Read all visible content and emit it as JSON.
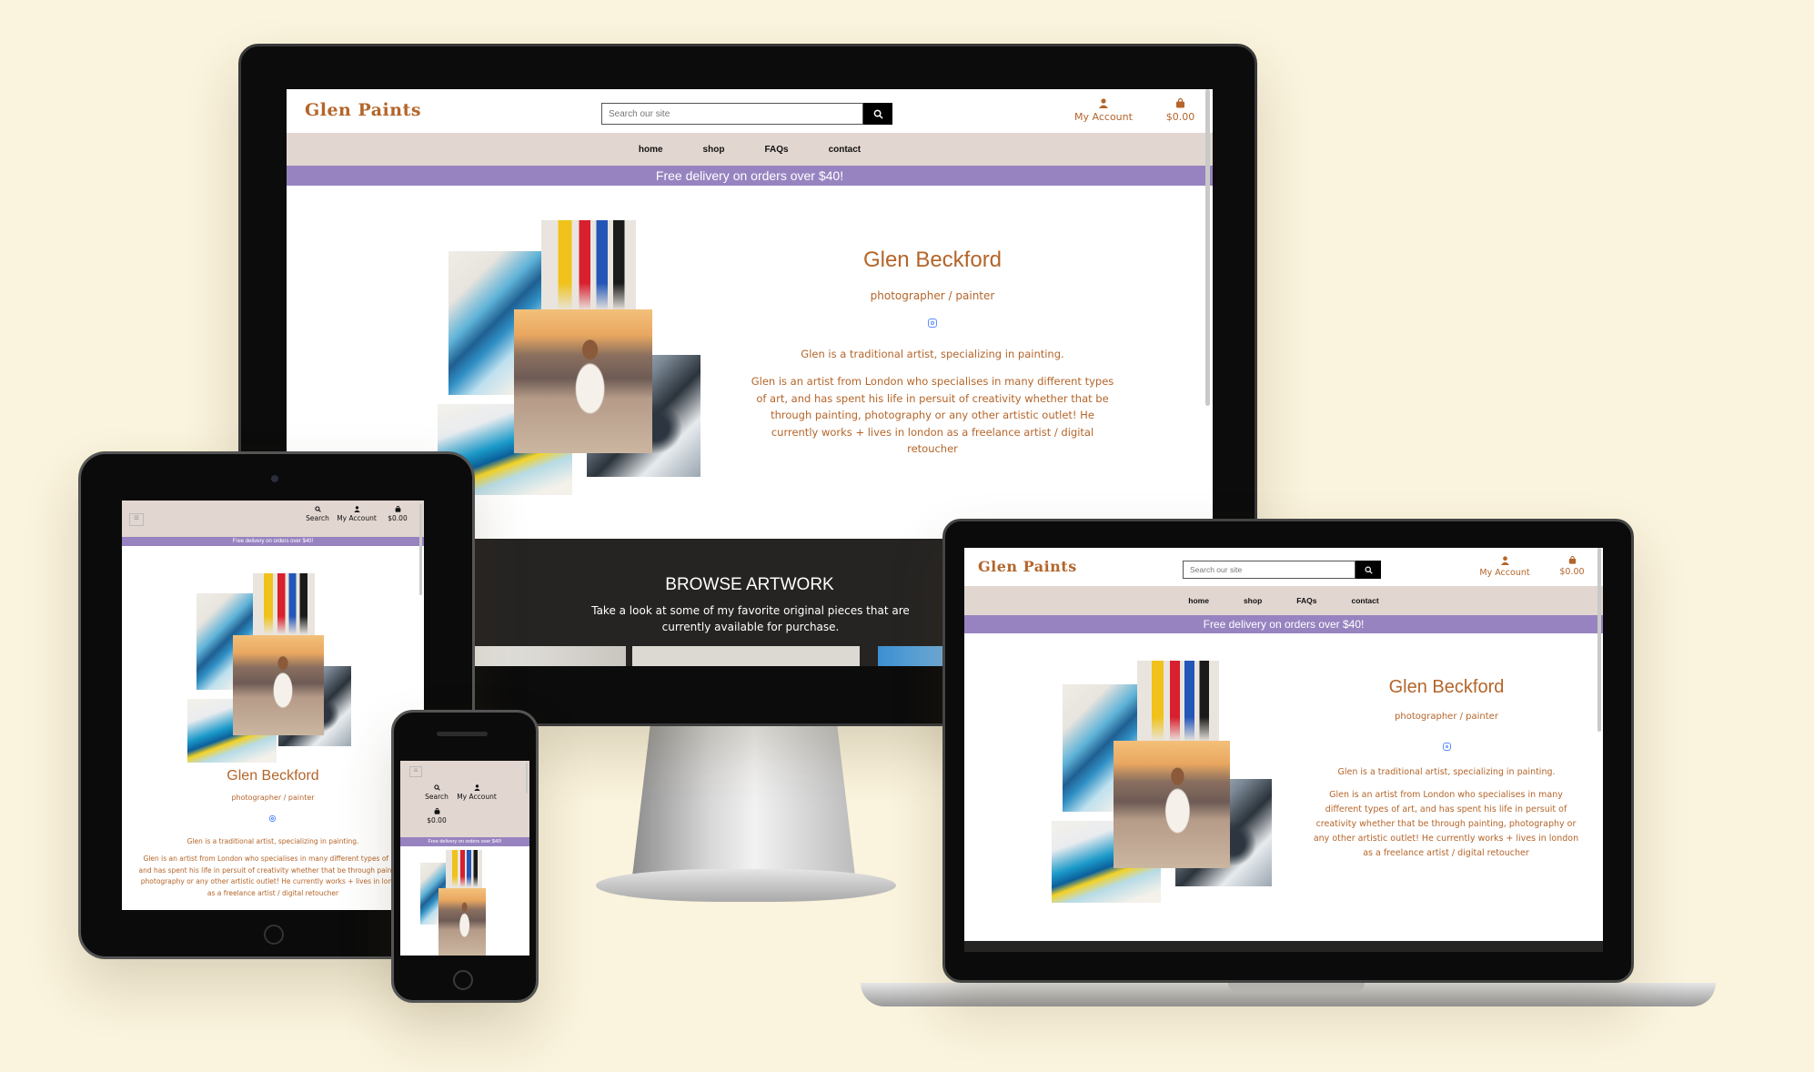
{
  "site": {
    "logo": "Glen Paints",
    "search_placeholder": "Search our site",
    "account_label": "My Account",
    "basket_total": "$0.00",
    "search_label": "Search",
    "nav": [
      "home",
      "shop",
      "FAQs",
      "contact"
    ],
    "promo": "Free delivery on orders over $40!",
    "artist_name": "Glen Beckford",
    "artist_role": "photographer / painter",
    "intro": "Glen is a traditional artist, specializing in painting.",
    "bio": "Glen is an artist from London who specialises in many different types of art, and has spent his life in persuit of creativity whether that be through painting, photography or any other artistic outlet! He currently works + lives in london as a freelance artist / digital retoucher",
    "browse_title": "BROWSE ARTWORK",
    "browse_text": "Take a look at some of my favorite original pieces that are currently available for purchase."
  },
  "icons": {
    "search": "search-icon",
    "account": "user-icon",
    "basket": "shopping-bag-icon",
    "instagram": "instagram-icon",
    "menu": "hamburger-menu-icon"
  },
  "colors": {
    "background": "#faf3dd",
    "brand": "#b4652a",
    "nav_bg": "#e2d6d0",
    "promo_bg": "#9783c0",
    "footer_bg": "#262423"
  }
}
